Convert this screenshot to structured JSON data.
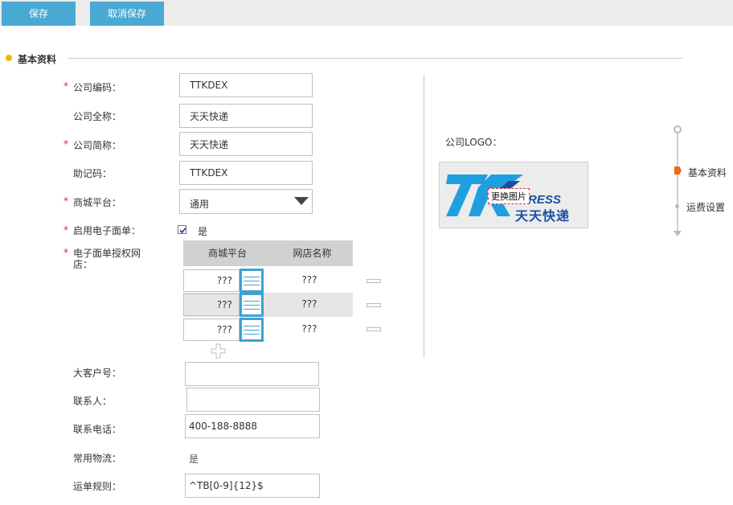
{
  "toolbar": {
    "save_label": "保存",
    "cancel_label": "取消保存"
  },
  "section": {
    "title": "基本资料"
  },
  "form": {
    "required_mark": "*",
    "company_code": {
      "label": "公司编码：",
      "value": "TTKDEX"
    },
    "company_fullname": {
      "label": "公司全称：",
      "value": "天天快递"
    },
    "company_shortname": {
      "label": "公司简称：",
      "value": "天天快递"
    },
    "mnemonic": {
      "label": "助记码：",
      "value": "TTKDEX"
    },
    "mall_platform": {
      "label": "商城平台：",
      "selected": "通用"
    },
    "enable_eform": {
      "label": "启用电子面单：",
      "checked": true,
      "checkbox_label": "是"
    },
    "auth_shops": {
      "label_line1": "电子面单授权网",
      "label_line2": "店："
    },
    "big_customer": {
      "label": "大客户号：",
      "value": ""
    },
    "contact": {
      "label": "联系人：",
      "value": ""
    },
    "phone": {
      "label": "联系电话：",
      "value": "400-188-8888"
    },
    "common_logistics": {
      "label": "常用物流：",
      "value": "是"
    },
    "waybill_rule": {
      "label": "运单规则：",
      "value": "^TB[0-9]{12}$"
    }
  },
  "shop_table": {
    "headers": [
      "商城平台",
      "网店名称"
    ],
    "rows": [
      {
        "platform": "???",
        "shop_name": "???"
      },
      {
        "platform": "???",
        "shop_name": "???"
      },
      {
        "platform": "???",
        "shop_name": "???"
      }
    ]
  },
  "logo": {
    "label": "公司LOGO：",
    "replace_label": "更换图片",
    "brand_text_en": "XPRESS",
    "brand_text_cn": "天天快递",
    "brand_mark": "TK",
    "brand_color": "#1f9fe0",
    "brand_dark": "#1a4fa0"
  },
  "side_nav": {
    "items": [
      "基本资料",
      "运费设置"
    ],
    "active_index": 0
  },
  "colors": {
    "primary": "#49a9d2",
    "accent_orange": "#ee6a10",
    "section_dot": "#f2b600",
    "required": "#e02020"
  }
}
